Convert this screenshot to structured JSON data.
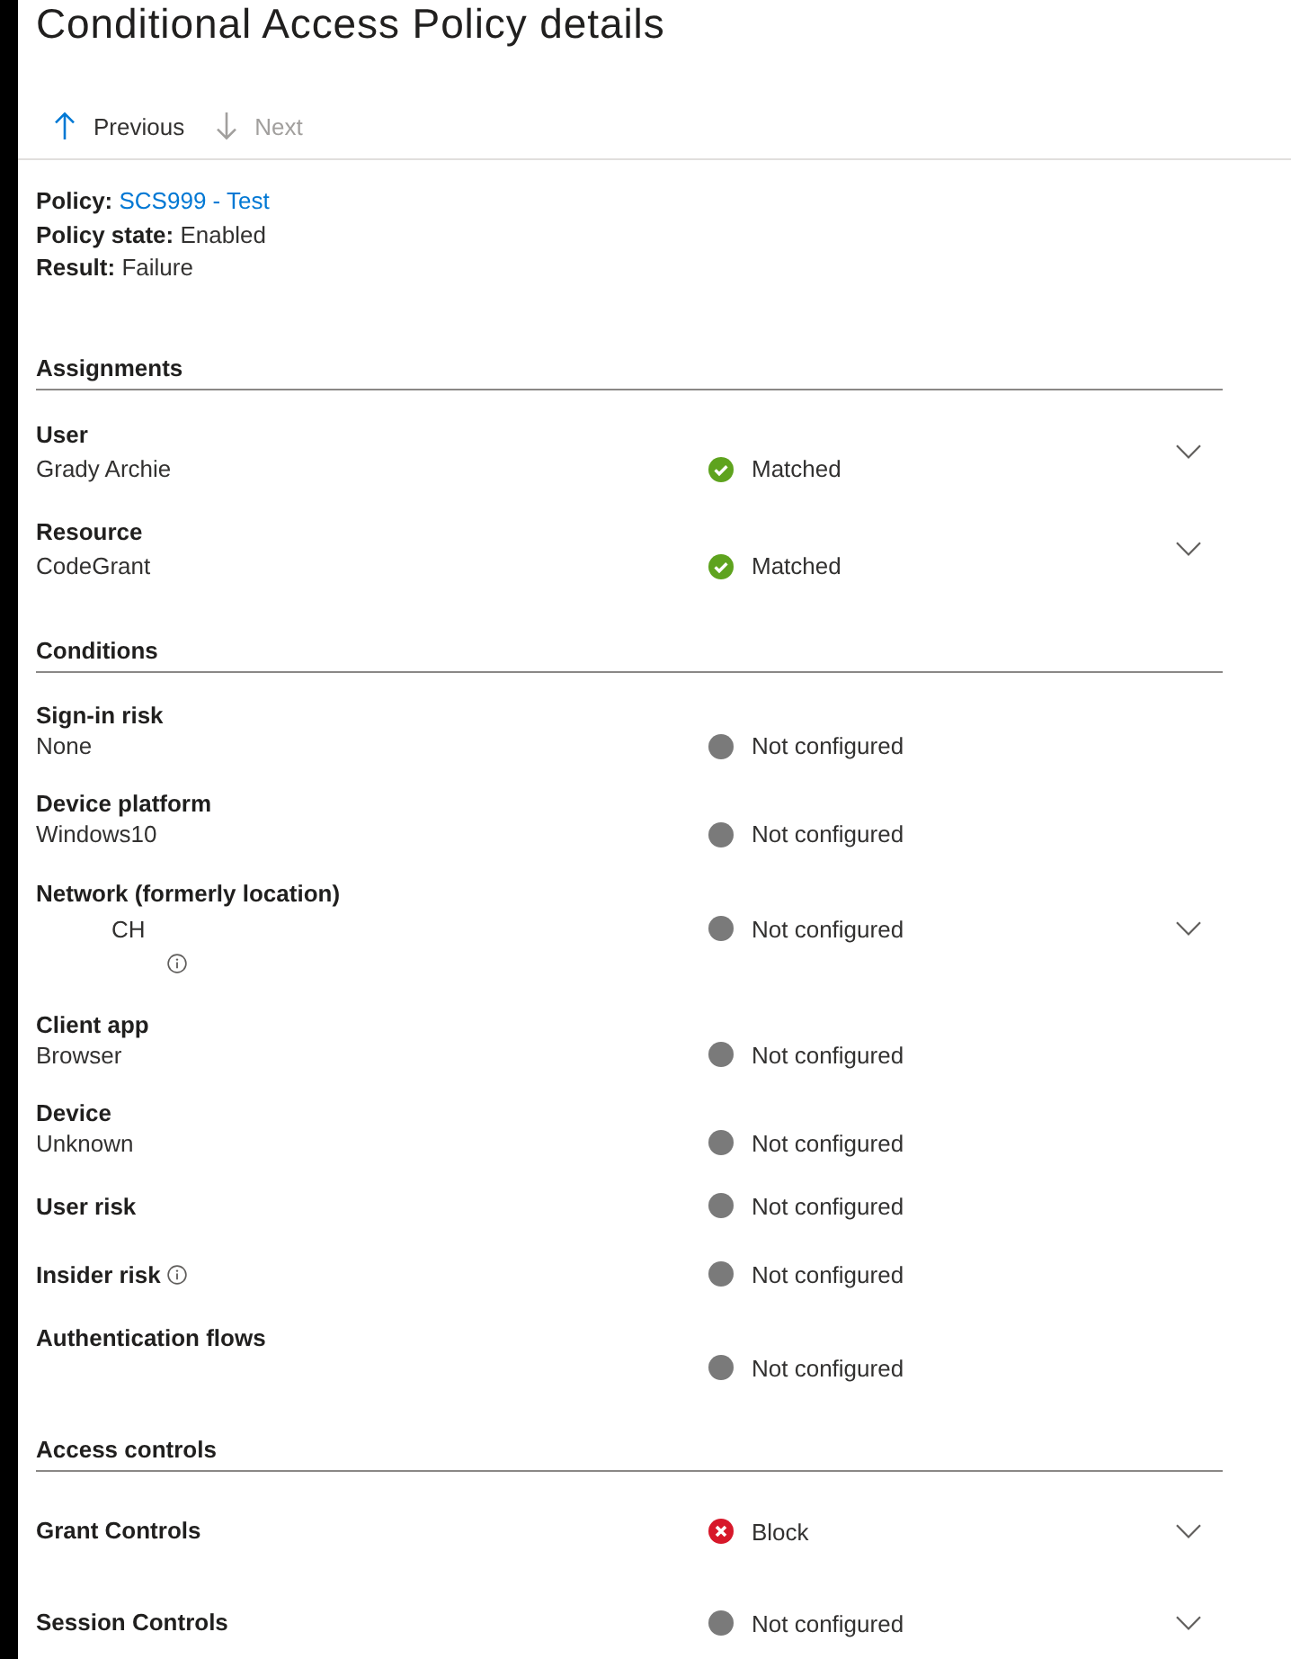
{
  "title": "Conditional Access Policy details",
  "toolbar": [
    {
      "label": "Previous",
      "disabled": false
    },
    {
      "label": "Next",
      "disabled": true
    }
  ],
  "summary": [
    {
      "label": "Policy:",
      "value": "SCS999 - Test",
      "kind": "link"
    },
    {
      "label": "Policy state:",
      "value": "Enabled",
      "kind": "text"
    },
    {
      "label": "Result:",
      "value": "Failure",
      "kind": "text"
    }
  ],
  "sections": [
    {
      "heading": "Assignments",
      "rows": [
        {
          "label": "User",
          "kind": "stacked",
          "info": false,
          "lines": [
            {
              "kind": "text",
              "text": "Grady Archie"
            }
          ],
          "status": {
            "kind": "matched",
            "text": "Matched"
          },
          "expandable": true
        },
        {
          "label": "Resource",
          "kind": "stacked",
          "info": false,
          "lines": [
            {
              "kind": "text",
              "text": "CodeGrant"
            }
          ],
          "status": {
            "kind": "matched",
            "text": "Matched"
          },
          "expandable": true
        }
      ]
    },
    {
      "heading": "Conditions",
      "rows": [
        {
          "label": "Sign-in risk",
          "kind": "stacked",
          "info": false,
          "lines": [
            {
              "kind": "text",
              "text": "None"
            }
          ],
          "status": {
            "kind": "none",
            "text": "Not configured"
          },
          "expandable": false
        },
        {
          "label": "Device platform",
          "kind": "stacked",
          "info": false,
          "lines": [
            {
              "kind": "text",
              "text": "Windows10"
            }
          ],
          "status": {
            "kind": "none",
            "text": "Not configured"
          },
          "expandable": false
        },
        {
          "label": "Network (formerly location)",
          "kind": "stacked",
          "info": false,
          "lines": [
            {
              "kind": "redacted-text",
              "text": "CH"
            },
            {
              "kind": "redacted-info"
            }
          ],
          "status": {
            "kind": "none",
            "text": "Not configured"
          },
          "expandable": true
        },
        {
          "label": "Client app",
          "kind": "stacked",
          "info": false,
          "lines": [
            {
              "kind": "text",
              "text": "Browser"
            }
          ],
          "status": {
            "kind": "none",
            "text": "Not configured"
          },
          "expandable": false
        },
        {
          "label": "Device",
          "kind": "stacked",
          "info": false,
          "lines": [
            {
              "kind": "text",
              "text": "Unknown"
            }
          ],
          "status": {
            "kind": "none",
            "text": "Not configured"
          },
          "expandable": false
        },
        {
          "label": "User risk",
          "kind": "inline",
          "info": false,
          "status": {
            "kind": "none",
            "text": "Not configured"
          },
          "expandable": false
        },
        {
          "label": "Insider risk",
          "kind": "inline",
          "info": true,
          "status": {
            "kind": "none",
            "text": "Not configured"
          },
          "expandable": false
        },
        {
          "label": "Authentication flows",
          "kind": "stacked",
          "info": false,
          "status": {
            "kind": "none",
            "text": "Not configured"
          },
          "expandable": false
        }
      ]
    },
    {
      "heading": "Access controls",
      "rows": [
        {
          "label": "Grant Controls",
          "kind": "inline",
          "info": false,
          "status": {
            "kind": "failed",
            "text": "Block"
          },
          "expandable": true
        },
        {
          "label": "Session Controls",
          "kind": "inline",
          "info": false,
          "status": {
            "kind": "none",
            "text": "Not configured"
          },
          "expandable": true
        }
      ]
    }
  ]
}
